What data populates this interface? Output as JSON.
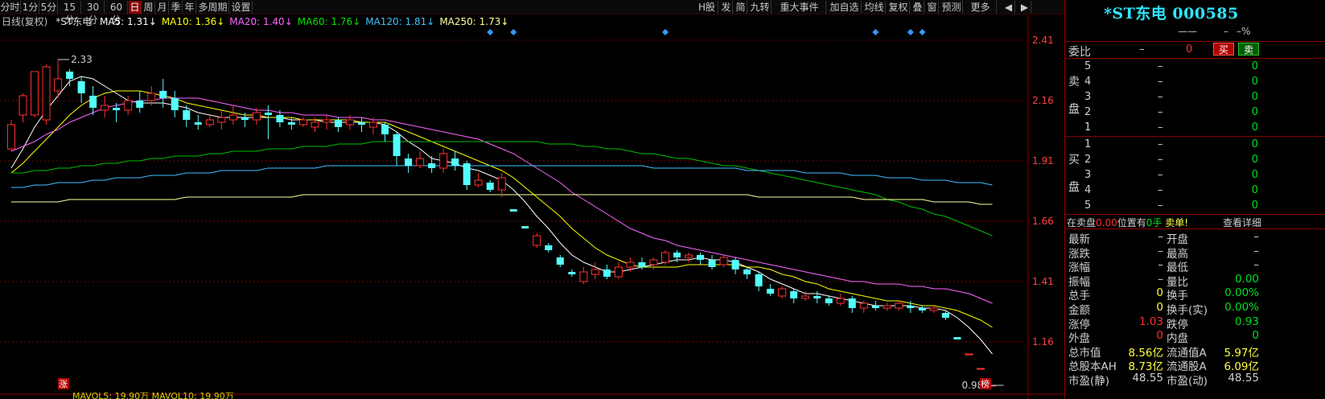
{
  "toolbar": {
    "left_items": [
      "分时",
      "1分",
      "5分",
      "15分",
      "30分",
      "60分",
      "日",
      "周",
      "月",
      "季",
      "年",
      "多周期",
      "设置"
    ],
    "active": "日",
    "right_items": [
      "H股",
      "发",
      "简",
      "九转",
      "重大事件",
      "加自选",
      "均线",
      "复权",
      "叠",
      "窗",
      "预测",
      "更多"
    ],
    "nav_prev": "◀",
    "nav_next": "▶"
  },
  "indicator": {
    "label": "日线(复权)",
    "name": "*ST东电",
    "ma": [
      {
        "text": "MA5: 1.31↓",
        "color": "#ffffff"
      },
      {
        "text": "MA10: 1.36↓",
        "color": "#ffff00"
      },
      {
        "text": "MA20: 1.40↓",
        "color": "#ff66ff"
      },
      {
        "text": "MA60: 1.76↓",
        "color": "#00e000"
      },
      {
        "text": "MA120: 1.81↓",
        "color": "#40c0ff"
      },
      {
        "text": "MA250: 1.73↓",
        "color": "#ffffa0"
      }
    ]
  },
  "chart_data": {
    "type": "candlestick",
    "y_ticks": [
      "2.41",
      "2.16",
      "1.91",
      "1.66",
      "1.41",
      "1.16"
    ],
    "ylim": [
      0.95,
      2.45
    ],
    "annotations": {
      "high": "2.33",
      "low": "0.98",
      "badge_up": "涨",
      "badge_rank": "榜"
    },
    "candles": [
      [
        1.96,
        2.06,
        1.95,
        2.08
      ],
      [
        2.1,
        2.18,
        2.07,
        2.19
      ],
      [
        2.1,
        2.28,
        2.09,
        2.28
      ],
      [
        2.08,
        2.3,
        2.06,
        2.31
      ],
      [
        2.2,
        2.25,
        2.17,
        2.33
      ],
      [
        2.28,
        2.25,
        2.22,
        2.29
      ],
      [
        2.24,
        2.19,
        2.15,
        2.26
      ],
      [
        2.18,
        2.13,
        2.1,
        2.22
      ],
      [
        2.12,
        2.14,
        2.09,
        2.18
      ],
      [
        2.13,
        2.12,
        2.07,
        2.15
      ],
      [
        2.12,
        2.16,
        2.1,
        2.18
      ],
      [
        2.16,
        2.13,
        2.11,
        2.2
      ],
      [
        2.16,
        2.19,
        2.14,
        2.22
      ],
      [
        2.2,
        2.17,
        2.13,
        2.25
      ],
      [
        2.17,
        2.12,
        2.09,
        2.2
      ],
      [
        2.12,
        2.08,
        2.05,
        2.14
      ],
      [
        2.07,
        2.06,
        2.04,
        2.1
      ],
      [
        2.06,
        2.08,
        2.05,
        2.1
      ],
      [
        2.07,
        2.09,
        2.04,
        2.12
      ],
      [
        2.08,
        2.1,
        2.06,
        2.14
      ],
      [
        2.09,
        2.08,
        2.05,
        2.11
      ],
      [
        2.08,
        2.11,
        2.06,
        2.13
      ],
      [
        2.11,
        2.1,
        2.0,
        2.14
      ],
      [
        2.1,
        2.07,
        2.05,
        2.12
      ],
      [
        2.07,
        2.06,
        2.04,
        2.09
      ],
      [
        2.06,
        2.08,
        2.05,
        2.09
      ],
      [
        2.05,
        2.07,
        2.03,
        2.09
      ],
      [
        2.07,
        2.08,
        2.04,
        2.1
      ],
      [
        2.08,
        2.05,
        2.03,
        2.09
      ],
      [
        2.06,
        2.08,
        2.04,
        2.1
      ],
      [
        2.07,
        2.06,
        2.03,
        2.09
      ],
      [
        2.05,
        2.07,
        2.02,
        2.09
      ],
      [
        2.06,
        2.02,
        1.99,
        2.07
      ],
      [
        2.02,
        1.93,
        1.89,
        2.03
      ],
      [
        1.92,
        1.89,
        1.86,
        1.94
      ],
      [
        1.89,
        1.92,
        1.88,
        1.95
      ],
      [
        1.9,
        1.88,
        1.86,
        1.93
      ],
      [
        1.88,
        1.94,
        1.86,
        1.96
      ],
      [
        1.92,
        1.89,
        1.87,
        1.95
      ],
      [
        1.9,
        1.81,
        1.79,
        1.91
      ],
      [
        1.81,
        1.83,
        1.8,
        1.86
      ],
      [
        1.82,
        1.79,
        1.78,
        1.83
      ],
      [
        1.79,
        1.84,
        1.76,
        1.86
      ],
      [
        1.71,
        1.7,
        1.7,
        1.71
      ],
      [
        1.64,
        1.63,
        1.63,
        1.64
      ],
      [
        1.56,
        1.6,
        1.55,
        1.61
      ],
      [
        1.56,
        1.54,
        1.53,
        1.57
      ],
      [
        1.51,
        1.48,
        1.47,
        1.52
      ],
      [
        1.45,
        1.44,
        1.43,
        1.46
      ],
      [
        1.41,
        1.45,
        1.4,
        1.47
      ],
      [
        1.44,
        1.46,
        1.42,
        1.49
      ],
      [
        1.46,
        1.43,
        1.42,
        1.48
      ],
      [
        1.43,
        1.47,
        1.42,
        1.49
      ],
      [
        1.47,
        1.49,
        1.45,
        1.51
      ],
      [
        1.49,
        1.47,
        1.46,
        1.51
      ],
      [
        1.48,
        1.5,
        1.46,
        1.51
      ],
      [
        1.49,
        1.53,
        1.48,
        1.54
      ],
      [
        1.53,
        1.51,
        1.49,
        1.54
      ],
      [
        1.51,
        1.52,
        1.49,
        1.53
      ],
      [
        1.52,
        1.5,
        1.48,
        1.53
      ],
      [
        1.5,
        1.47,
        1.46,
        1.52
      ],
      [
        1.48,
        1.51,
        1.47,
        1.52
      ],
      [
        1.5,
        1.46,
        1.44,
        1.51
      ],
      [
        1.46,
        1.44,
        1.42,
        1.47
      ],
      [
        1.44,
        1.39,
        1.37,
        1.45
      ],
      [
        1.38,
        1.36,
        1.35,
        1.4
      ],
      [
        1.35,
        1.38,
        1.34,
        1.39
      ],
      [
        1.37,
        1.34,
        1.32,
        1.38
      ],
      [
        1.34,
        1.35,
        1.33,
        1.37
      ],
      [
        1.35,
        1.34,
        1.32,
        1.37
      ],
      [
        1.34,
        1.32,
        1.31,
        1.35
      ],
      [
        1.32,
        1.34,
        1.31,
        1.36
      ],
      [
        1.34,
        1.3,
        1.28,
        1.35
      ],
      [
        1.3,
        1.32,
        1.28,
        1.33
      ],
      [
        1.31,
        1.3,
        1.29,
        1.33
      ],
      [
        1.3,
        1.31,
        1.29,
        1.32
      ],
      [
        1.3,
        1.32,
        1.29,
        1.33
      ],
      [
        1.31,
        1.3,
        1.28,
        1.33
      ],
      [
        1.3,
        1.29,
        1.28,
        1.31
      ],
      [
        1.29,
        1.3,
        1.28,
        1.31
      ],
      [
        1.28,
        1.26,
        1.25,
        1.29
      ],
      [
        1.18,
        1.17,
        1.17,
        1.18
      ],
      [
        1.11,
        1.11,
        1.11,
        1.11
      ],
      [
        1.05,
        1.05,
        1.05,
        1.05
      ],
      [
        0.98,
        0.98,
        0.98,
        0.98
      ]
    ],
    "ma_series": [
      {
        "name": "MA5",
        "color": "#ffffff",
        "values": [
          1.88,
          1.96,
          2.05,
          2.12,
          2.18,
          2.24,
          2.26,
          2.25,
          2.22,
          2.19,
          2.16,
          2.15,
          2.15,
          2.15,
          2.14,
          2.13,
          2.11,
          2.1,
          2.09,
          2.09,
          2.09,
          2.09,
          2.09,
          2.09,
          2.08,
          2.08,
          2.08,
          2.07,
          2.07,
          2.07,
          2.07,
          2.07,
          2.06,
          2.03,
          1.99,
          1.96,
          1.92,
          1.91,
          1.9,
          1.88,
          1.87,
          1.85,
          1.83,
          1.79,
          1.74,
          1.68,
          1.63,
          1.57,
          1.52,
          1.49,
          1.47,
          1.45,
          1.45,
          1.46,
          1.47,
          1.48,
          1.49,
          1.5,
          1.5,
          1.51,
          1.5,
          1.5,
          1.49,
          1.47,
          1.45,
          1.42,
          1.4,
          1.38,
          1.36,
          1.36,
          1.35,
          1.34,
          1.33,
          1.32,
          1.31,
          1.31,
          1.31,
          1.31,
          1.3,
          1.3,
          1.29,
          1.26,
          1.22,
          1.17,
          1.11
        ]
      },
      {
        "name": "MA10",
        "color": "#ffff00",
        "values": [
          1.86,
          1.9,
          1.95,
          2.0,
          2.05,
          2.1,
          2.14,
          2.17,
          2.19,
          2.2,
          2.2,
          2.2,
          2.19,
          2.18,
          2.17,
          2.15,
          2.14,
          2.13,
          2.12,
          2.11,
          2.1,
          2.1,
          2.09,
          2.09,
          2.09,
          2.08,
          2.08,
          2.08,
          2.08,
          2.08,
          2.07,
          2.07,
          2.07,
          2.05,
          2.03,
          2.01,
          1.99,
          1.97,
          1.95,
          1.93,
          1.91,
          1.89,
          1.87,
          1.84,
          1.8,
          1.76,
          1.72,
          1.68,
          1.63,
          1.59,
          1.55,
          1.52,
          1.5,
          1.48,
          1.47,
          1.47,
          1.47,
          1.47,
          1.48,
          1.48,
          1.48,
          1.48,
          1.48,
          1.47,
          1.47,
          1.46,
          1.44,
          1.43,
          1.41,
          1.4,
          1.38,
          1.37,
          1.36,
          1.35,
          1.34,
          1.33,
          1.33,
          1.32,
          1.31,
          1.31,
          1.3,
          1.29,
          1.27,
          1.25,
          1.22
        ]
      },
      {
        "name": "MA20",
        "color": "#ff66ff",
        "values": [
          1.95,
          1.97,
          1.99,
          2.02,
          2.04,
          2.07,
          2.09,
          2.11,
          2.13,
          2.14,
          2.15,
          2.16,
          2.16,
          2.17,
          2.17,
          2.17,
          2.17,
          2.16,
          2.15,
          2.14,
          2.13,
          2.12,
          2.12,
          2.11,
          2.11,
          2.1,
          2.1,
          2.1,
          2.09,
          2.09,
          2.09,
          2.08,
          2.08,
          2.07,
          2.06,
          2.05,
          2.04,
          2.03,
          2.02,
          2.01,
          2.0,
          1.98,
          1.96,
          1.94,
          1.91,
          1.88,
          1.85,
          1.82,
          1.78,
          1.75,
          1.72,
          1.69,
          1.66,
          1.63,
          1.61,
          1.59,
          1.58,
          1.56,
          1.55,
          1.54,
          1.53,
          1.52,
          1.51,
          1.5,
          1.49,
          1.48,
          1.47,
          1.46,
          1.45,
          1.44,
          1.43,
          1.42,
          1.41,
          1.41,
          1.4,
          1.4,
          1.4,
          1.39,
          1.39,
          1.38,
          1.38,
          1.37,
          1.36,
          1.34,
          1.32
        ]
      },
      {
        "name": "MA60",
        "color": "#00c000",
        "values": [
          1.86,
          1.86,
          1.87,
          1.87,
          1.88,
          1.88,
          1.89,
          1.89,
          1.9,
          1.9,
          1.91,
          1.91,
          1.92,
          1.92,
          1.93,
          1.93,
          1.93,
          1.94,
          1.94,
          1.95,
          1.95,
          1.95,
          1.96,
          1.96,
          1.96,
          1.97,
          1.97,
          1.97,
          1.98,
          1.98,
          1.98,
          1.99,
          1.99,
          1.99,
          1.99,
          1.99,
          1.99,
          1.99,
          1.99,
          1.99,
          1.99,
          1.99,
          1.99,
          1.99,
          1.99,
          1.99,
          1.98,
          1.98,
          1.98,
          1.97,
          1.97,
          1.96,
          1.96,
          1.95,
          1.94,
          1.94,
          1.93,
          1.92,
          1.92,
          1.91,
          1.9,
          1.89,
          1.89,
          1.88,
          1.87,
          1.86,
          1.85,
          1.84,
          1.83,
          1.82,
          1.81,
          1.8,
          1.79,
          1.78,
          1.77,
          1.75,
          1.74,
          1.72,
          1.71,
          1.69,
          1.68,
          1.66,
          1.64,
          1.62,
          1.6
        ]
      },
      {
        "name": "MA120",
        "color": "#40c0ff",
        "values": [
          1.8,
          1.8,
          1.81,
          1.81,
          1.82,
          1.82,
          1.82,
          1.83,
          1.83,
          1.84,
          1.84,
          1.84,
          1.85,
          1.85,
          1.85,
          1.86,
          1.86,
          1.86,
          1.87,
          1.87,
          1.87,
          1.87,
          1.88,
          1.88,
          1.88,
          1.88,
          1.88,
          1.89,
          1.89,
          1.89,
          1.89,
          1.89,
          1.89,
          1.89,
          1.89,
          1.89,
          1.89,
          1.89,
          1.89,
          1.89,
          1.89,
          1.89,
          1.89,
          1.89,
          1.89,
          1.89,
          1.89,
          1.89,
          1.89,
          1.89,
          1.89,
          1.89,
          1.89,
          1.89,
          1.89,
          1.88,
          1.88,
          1.88,
          1.88,
          1.88,
          1.88,
          1.88,
          1.88,
          1.87,
          1.87,
          1.87,
          1.87,
          1.87,
          1.86,
          1.86,
          1.86,
          1.86,
          1.85,
          1.85,
          1.85,
          1.84,
          1.84,
          1.84,
          1.83,
          1.83,
          1.83,
          1.82,
          1.82,
          1.82,
          1.81
        ]
      },
      {
        "name": "MA250",
        "color": "#ffffa0",
        "values": [
          1.74,
          1.74,
          1.74,
          1.74,
          1.74,
          1.75,
          1.75,
          1.75,
          1.75,
          1.75,
          1.75,
          1.75,
          1.75,
          1.75,
          1.75,
          1.76,
          1.76,
          1.76,
          1.76,
          1.76,
          1.76,
          1.76,
          1.76,
          1.76,
          1.76,
          1.77,
          1.77,
          1.77,
          1.77,
          1.77,
          1.77,
          1.77,
          1.77,
          1.77,
          1.77,
          1.77,
          1.77,
          1.77,
          1.77,
          1.77,
          1.77,
          1.77,
          1.77,
          1.77,
          1.77,
          1.77,
          1.77,
          1.77,
          1.77,
          1.77,
          1.77,
          1.77,
          1.77,
          1.77,
          1.77,
          1.77,
          1.77,
          1.77,
          1.77,
          1.77,
          1.77,
          1.77,
          1.77,
          1.77,
          1.76,
          1.76,
          1.76,
          1.76,
          1.76,
          1.76,
          1.76,
          1.76,
          1.76,
          1.75,
          1.75,
          1.75,
          1.75,
          1.75,
          1.75,
          1.74,
          1.74,
          1.74,
          1.74,
          1.73,
          1.73
        ]
      }
    ],
    "markers_at": [
      41,
      43,
      56,
      74,
      77,
      78
    ],
    "marker_color": "#3399ff"
  },
  "panel": {
    "title": "*ST东电 000585",
    "price_line": {
      "dash": "——",
      "sep": "–",
      "pct": "–%"
    },
    "weibi": {
      "label": "委比",
      "value": "–",
      "count": "0",
      "buy_btn": "买",
      "sell_btn": "卖"
    },
    "sell_label": [
      "卖",
      "盘"
    ],
    "sell_rows": [
      {
        "n": "5",
        "p": "–",
        "v": "0"
      },
      {
        "n": "4",
        "p": "–",
        "v": "0"
      },
      {
        "n": "3",
        "p": "–",
        "v": "0"
      },
      {
        "n": "2",
        "p": "–",
        "v": "0"
      },
      {
        "n": "1",
        "p": "–",
        "v": "0"
      }
    ],
    "buy_label": [
      "买",
      "盘"
    ],
    "buy_rows": [
      {
        "n": "1",
        "p": "–",
        "v": "0"
      },
      {
        "n": "2",
        "p": "–",
        "v": "0"
      },
      {
        "n": "3",
        "p": "–",
        "v": "0"
      },
      {
        "n": "4",
        "p": "–",
        "v": "0"
      },
      {
        "n": "5",
        "p": "–",
        "v": "0"
      }
    ],
    "notice": {
      "a": "在卖盘",
      "b": "0.00",
      "c": "位置有",
      "d": "0手",
      "e": "卖单!",
      "link": "查看详细"
    },
    "stats": [
      {
        "k1": "最新",
        "v1": "–",
        "k2": "开盘",
        "v2": "–",
        "c1": "white",
        "c2": "white"
      },
      {
        "k1": "涨跌",
        "v1": "–",
        "k2": "最高",
        "v2": "–",
        "c1": "white",
        "c2": "white"
      },
      {
        "k1": "涨幅",
        "v1": "–",
        "k2": "最低",
        "v2": "–",
        "c1": "white",
        "c2": "white"
      },
      {
        "k1": "振幅",
        "v1": "–",
        "k2": "量比",
        "v2": "0.00",
        "c1": "white",
        "c2": "green"
      },
      {
        "k1": "总手",
        "v1": "0",
        "k2": "换手",
        "v2": "0.00%",
        "c1": "yellow",
        "c2": "green"
      },
      {
        "k1": "金额",
        "v1": "0",
        "k2": "换手(实)",
        "v2": "0.00%",
        "c1": "yellow",
        "c2": "green"
      },
      {
        "k1": "涨停",
        "v1": "1.03",
        "k2": "跌停",
        "v2": "0.93",
        "c1": "red",
        "c2": "green"
      },
      {
        "k1": "外盘",
        "v1": "0",
        "k2": "内盘",
        "v2": "0",
        "c1": "red",
        "c2": "green"
      },
      {
        "k1": "总市值",
        "v1": "8.56亿",
        "k2": "流通值A",
        "v2": "5.97亿",
        "c1": "yellow",
        "c2": "yellow"
      },
      {
        "k1": "总股本AH",
        "v1": "8.73亿",
        "k2": "流通股A",
        "v2": "6.09亿",
        "c1": "yellow",
        "c2": "yellow"
      },
      {
        "k1": "市盈(静)",
        "v1": "48.55",
        "k2": "市盈(动)",
        "v2": "48.55",
        "c1": "white",
        "c2": "white"
      }
    ]
  },
  "bottom_text": "MAVOL5: 19.90万 MAVOL10: 19.90万"
}
